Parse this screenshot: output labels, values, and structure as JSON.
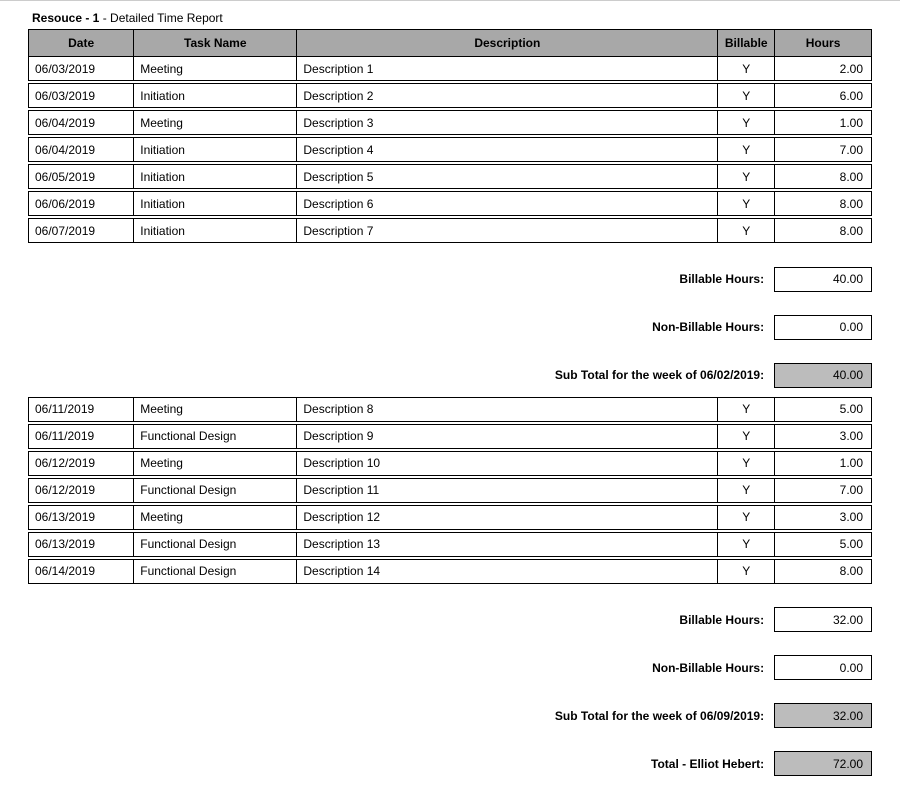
{
  "title": {
    "prefix": "Resouce - 1",
    "sep": " - ",
    "suffix": "Detailed Time Report"
  },
  "headers": {
    "date": "Date",
    "task": "Task Name",
    "description": "Description",
    "billable": "Billable",
    "hours": "Hours"
  },
  "week1": {
    "rows": [
      {
        "date": "06/03/2019",
        "task": "Meeting",
        "description": "Description 1",
        "billable": "Y",
        "hours": "2.00"
      },
      {
        "date": "06/03/2019",
        "task": "Initiation",
        "description": "Description 2",
        "billable": "Y",
        "hours": "6.00"
      },
      {
        "date": "06/04/2019",
        "task": "Meeting",
        "description": "Description 3",
        "billable": "Y",
        "hours": "1.00"
      },
      {
        "date": "06/04/2019",
        "task": "Initiation",
        "description": "Description 4",
        "billable": "Y",
        "hours": "7.00"
      },
      {
        "date": "06/05/2019",
        "task": "Initiation",
        "description": "Description 5",
        "billable": "Y",
        "hours": "8.00"
      },
      {
        "date": "06/06/2019",
        "task": "Initiation",
        "description": "Description 6",
        "billable": "Y",
        "hours": "8.00"
      },
      {
        "date": "06/07/2019",
        "task": "Initiation",
        "description": "Description 7",
        "billable": "Y",
        "hours": "8.00"
      }
    ],
    "billable_label": "Billable Hours:",
    "billable_value": "40.00",
    "nonbillable_label": "Non-Billable Hours:",
    "nonbillable_value": "0.00",
    "subtotal_label": "Sub Total for the week of 06/02/2019:",
    "subtotal_value": "40.00"
  },
  "week2": {
    "rows": [
      {
        "date": "06/11/2019",
        "task": "Meeting",
        "description": "Description 8",
        "billable": "Y",
        "hours": "5.00"
      },
      {
        "date": "06/11/2019",
        "task": "Functional Design",
        "description": "Description 9",
        "billable": "Y",
        "hours": "3.00"
      },
      {
        "date": "06/12/2019",
        "task": "Meeting",
        "description": "Description 10",
        "billable": "Y",
        "hours": "1.00"
      },
      {
        "date": "06/12/2019",
        "task": "Functional Design",
        "description": "Description 11",
        "billable": "Y",
        "hours": "7.00"
      },
      {
        "date": "06/13/2019",
        "task": "Meeting",
        "description": "Description 12",
        "billable": "Y",
        "hours": "3.00"
      },
      {
        "date": "06/13/2019",
        "task": "Functional Design",
        "description": "Description 13",
        "billable": "Y",
        "hours": "5.00"
      },
      {
        "date": "06/14/2019",
        "task": "Functional Design",
        "description": "Description 14",
        "billable": "Y",
        "hours": "8.00"
      }
    ],
    "billable_label": "Billable Hours:",
    "billable_value": "32.00",
    "nonbillable_label": "Non-Billable Hours:",
    "nonbillable_value": "0.00",
    "subtotal_label": "Sub Total for the week of 06/09/2019:",
    "subtotal_value": "32.00",
    "total_label": "Total - Elliot Hebert:",
    "total_value": "72.00"
  }
}
